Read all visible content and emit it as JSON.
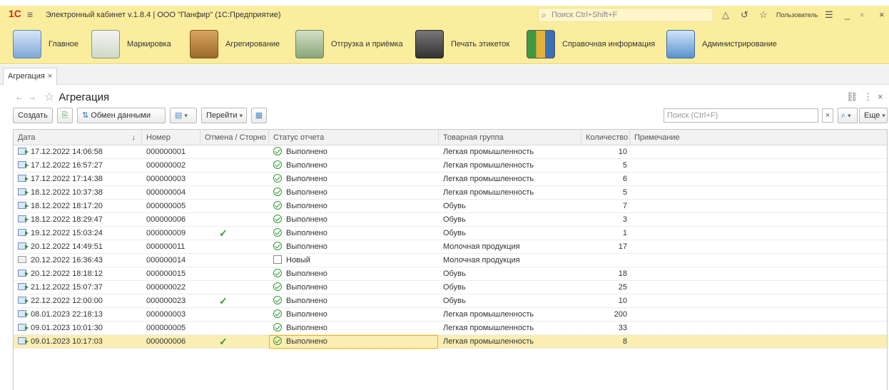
{
  "app": {
    "title": "Электронный кабинет v.1.8.4 | ООО \"Панфир\" (1С:Предприятие)",
    "logo": "1С",
    "search_placeholder": "Поиск Ctrl+Shift+F",
    "user": "Пользователь"
  },
  "sections": [
    {
      "label": "Главное",
      "icon": "home-icon"
    },
    {
      "label": "Маркировка",
      "icon": "checklist-icon"
    },
    {
      "label": "Агрегирование",
      "icon": "box-icon"
    },
    {
      "label": "Отгрузка и приёмка",
      "icon": "truck-icon"
    },
    {
      "label": "Печать этикеток",
      "icon": "printer-icon"
    },
    {
      "label": "Справочная информация",
      "icon": "books-icon"
    },
    {
      "label": "Администрирование",
      "icon": "computer-icon"
    }
  ],
  "tab": {
    "label": "Агрегация",
    "close": "×"
  },
  "form": {
    "title": "Агрегация"
  },
  "toolbar": {
    "create": "Создать",
    "exchange": "Обмен данными",
    "goto": "Перейти",
    "search_placeholder": "Поиск (Ctrl+F)",
    "more": "Еще"
  },
  "columns": [
    "Дата",
    "Номер",
    "Отмена / Сторно",
    "Статус отчета",
    "Товарная группа",
    "Количество",
    "Примечание"
  ],
  "rows": [
    {
      "date": "17.12.2022 14:06:58",
      "number": "000000001",
      "cancel": "",
      "status": "Выполнено",
      "group": "Легкая промышленность",
      "qty": "10",
      "note": ""
    },
    {
      "date": "17.12.2022 16:57:27",
      "number": "000000002",
      "cancel": "",
      "status": "Выполнено",
      "group": "Легкая промышленность",
      "qty": "5",
      "note": ""
    },
    {
      "date": "17.12.2022 17:14:38",
      "number": "000000003",
      "cancel": "",
      "status": "Выполнено",
      "group": "Легкая промышленность",
      "qty": "6",
      "note": ""
    },
    {
      "date": "18.12.2022 10:37:38",
      "number": "000000004",
      "cancel": "",
      "status": "Выполнено",
      "group": "Легкая промышленность",
      "qty": "5",
      "note": ""
    },
    {
      "date": "18.12.2022 18:17:20",
      "number": "000000005",
      "cancel": "",
      "status": "Выполнено",
      "group": "Обувь",
      "qty": "7",
      "note": ""
    },
    {
      "date": "18.12.2022 18:29:47",
      "number": "000000006",
      "cancel": "",
      "status": "Выполнено",
      "group": "Обувь",
      "qty": "3",
      "note": ""
    },
    {
      "date": "19.12.2022 15:03:24",
      "number": "000000009",
      "cancel": "✓",
      "status": "Выполнено",
      "group": "Обувь",
      "qty": "1",
      "note": ""
    },
    {
      "date": "20.12.2022 14:49:51",
      "number": "000000011",
      "cancel": "",
      "status": "Выполнено",
      "group": "Молочная продукция",
      "qty": "17",
      "note": ""
    },
    {
      "date": "20.12.2022 16:36:43",
      "number": "000000014",
      "cancel": "",
      "status": "Новый",
      "group": "Молочная продукция",
      "qty": "",
      "note": ""
    },
    {
      "date": "20.12.2022 18:18:12",
      "number": "000000015",
      "cancel": "",
      "status": "Выполнено",
      "group": "Обувь",
      "qty": "18",
      "note": ""
    },
    {
      "date": "21.12.2022 15:07:37",
      "number": "000000022",
      "cancel": "",
      "status": "Выполнено",
      "group": "Обувь",
      "qty": "25",
      "note": ""
    },
    {
      "date": "22.12.2022 12:00:00",
      "number": "000000023",
      "cancel": "✓",
      "status": "Выполнено",
      "group": "Обувь",
      "qty": "10",
      "note": ""
    },
    {
      "date": "08.01.2023 22:18:13",
      "number": "000000003",
      "cancel": "",
      "status": "Выполнено",
      "group": "Легкая промышленность",
      "qty": "200",
      "note": ""
    },
    {
      "date": "09.01.2023 10:01:30",
      "number": "000000005",
      "cancel": "",
      "status": "Выполнено",
      "group": "Легкая промышленность",
      "qty": "33",
      "note": ""
    },
    {
      "date": "09.01.2023 10:17:03",
      "number": "000000006",
      "cancel": "✓",
      "status": "Выполнено",
      "group": "Легкая промышленность",
      "qty": "8",
      "note": ""
    }
  ],
  "colors": {
    "accent": "#fbed9e",
    "selected_row": "#fbeeb3",
    "ok_green": "#2e9b35"
  }
}
